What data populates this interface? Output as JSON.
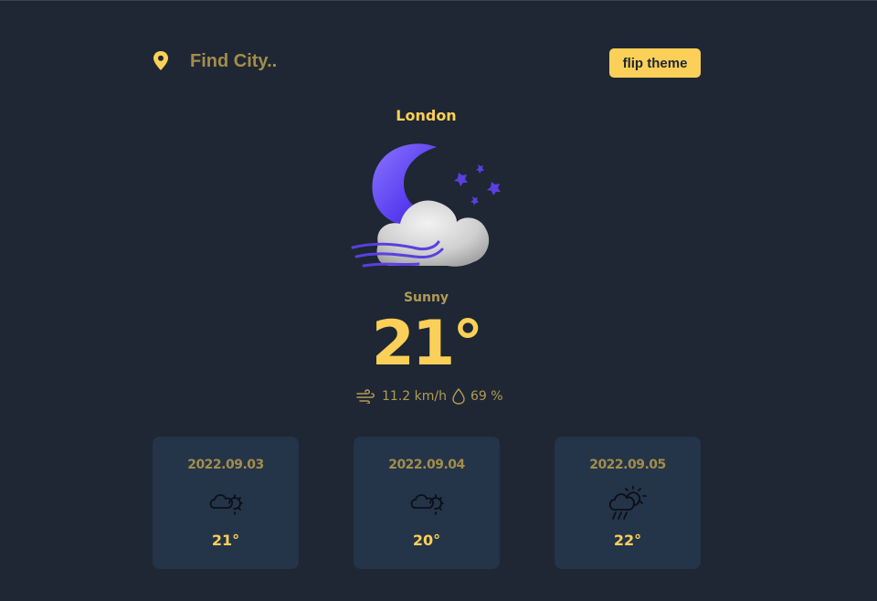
{
  "search": {
    "placeholder": "Find City..",
    "icon": "map-pin-icon"
  },
  "theme_button": {
    "label": "flip theme"
  },
  "current": {
    "city": "London",
    "icon": "night-cloudy-windy-icon",
    "condition": "Sunny",
    "temperature": "21°",
    "wind": "11.2 km/h",
    "humidity": "69 %"
  },
  "forecast": [
    {
      "date": "2022.09.03",
      "icon": "partly-cloudy-icon",
      "temp": "21°"
    },
    {
      "date": "2022.09.04",
      "icon": "partly-cloudy-icon",
      "temp": "20°"
    },
    {
      "date": "2022.09.05",
      "icon": "rain-sun-icon",
      "temp": "22°"
    }
  ],
  "colors": {
    "background": "#1e2733",
    "accent": "#fcd058",
    "muted": "#a38d4a",
    "card": "#243449"
  }
}
